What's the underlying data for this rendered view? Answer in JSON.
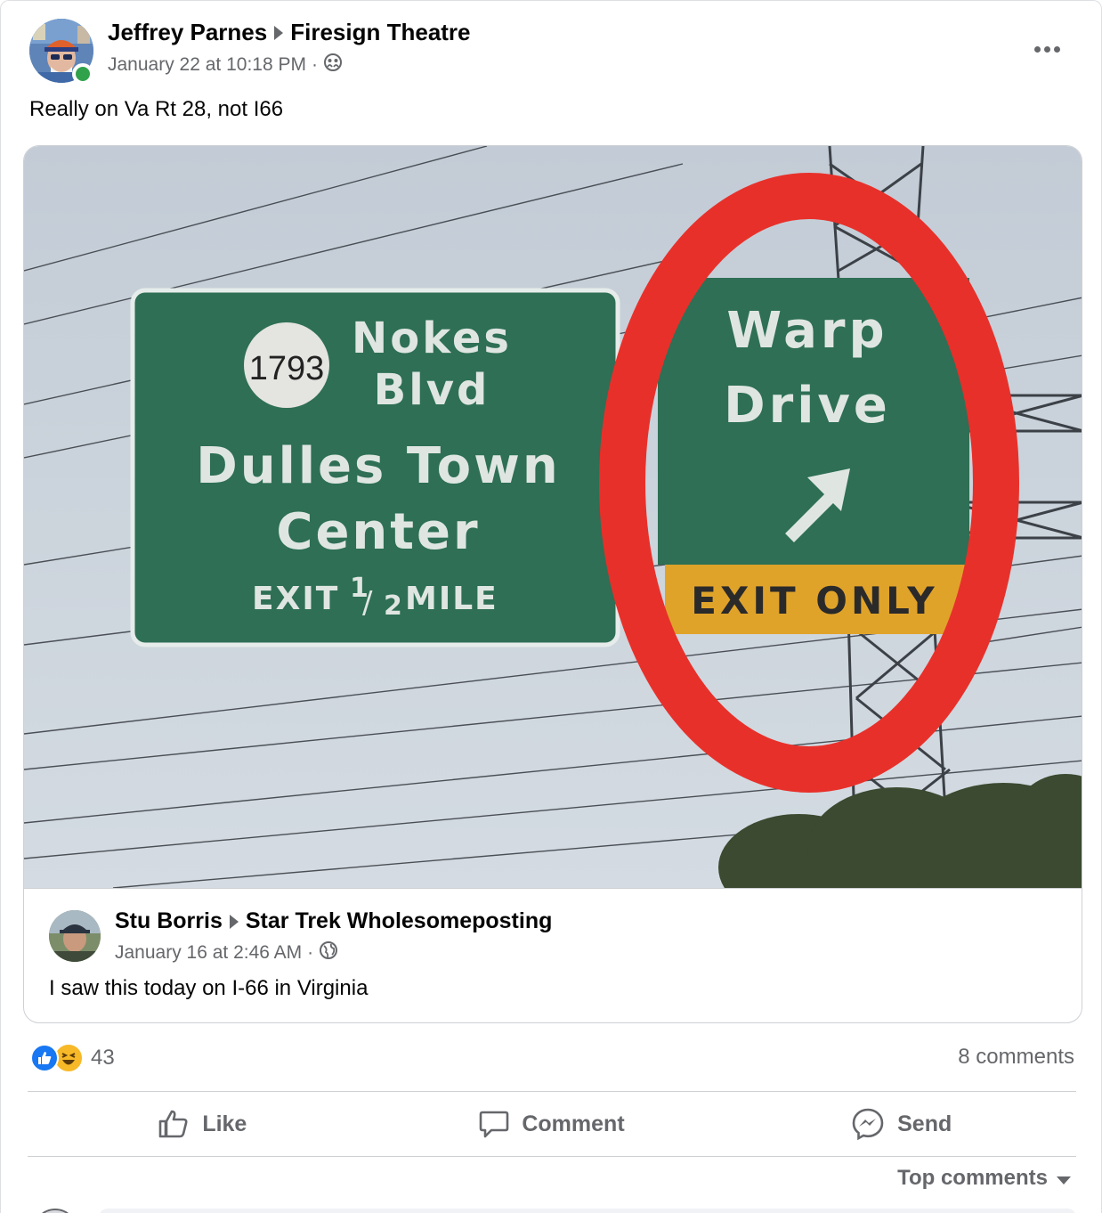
{
  "post": {
    "author": "Jeffrey Parnes",
    "group": "Firesign Theatre",
    "timestamp": "January 22 at 10:18 PM",
    "separator": "·",
    "privacy_icon": "group-icon",
    "text": "Really on Va Rt 28, not I66"
  },
  "shared": {
    "author": "Stu Borris",
    "group": "Star Trek Wholesomeposting",
    "timestamp": "January 16 at 2:46 AM",
    "separator": "·",
    "privacy_icon": "globe-icon",
    "text": "I saw this today on I-66 in Virginia"
  },
  "photo": {
    "left_sign": {
      "route_number": "1793",
      "line1": "Nokes",
      "line2": "Blvd",
      "line3": "Dulles Town",
      "line4": "Center",
      "exit_prefix": "EXIT ",
      "exit_fraction_num": "1",
      "exit_fraction_den": "2",
      "exit_suffix": " MILE"
    },
    "right_sign": {
      "line1": "Warp",
      "line2": "Drive",
      "panel": "EXIT ONLY"
    },
    "colors": {
      "sign_green": "#2e6f55",
      "exit_yellow": "#e0a32a",
      "circle_red": "#e8302a",
      "sky": "#c6cfd8"
    }
  },
  "stats": {
    "reaction_count": "43",
    "comments": "8 comments"
  },
  "actions": {
    "like": "Like",
    "comment": "Comment",
    "send": "Send"
  },
  "sort": {
    "label": "Top comments"
  },
  "colors": {
    "accent": "#1877f2",
    "online": "#31a24c",
    "secondary_text": "#65676b",
    "haha": "#f7b928"
  }
}
